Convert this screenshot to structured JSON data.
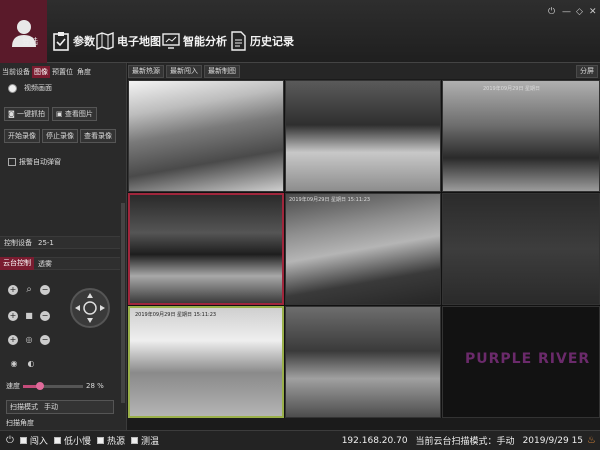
{
  "header": {
    "login_label": "登陆",
    "nav": [
      {
        "label": "参数",
        "icon": "clipboard-check-icon"
      },
      {
        "label": "电子地图",
        "icon": "map-icon"
      },
      {
        "label": "智能分析",
        "icon": "monitor-analysis-icon"
      },
      {
        "label": "历史记录",
        "icon": "history-document-icon"
      }
    ],
    "window_controls": [
      "power-icon",
      "minimize-icon",
      "restore-icon",
      "close-icon"
    ]
  },
  "left_panel": {
    "tabs": [
      "当前设备",
      "图像",
      "预置位",
      "角度"
    ],
    "active_tab": 1,
    "view_label": "视频画面",
    "buttons_row1": [
      "一键抓拍",
      "查看图片"
    ],
    "buttons_row2": [
      "开始录像",
      "停止录像",
      "查看录像"
    ],
    "alarm_label": "报警自动弹窗",
    "control_device_label": "控制设备",
    "control_device_value": "25-1",
    "ptz_tabs": [
      "云台控制",
      "透雾"
    ],
    "speed_label": "速度",
    "speed_value": "28 %",
    "speed_fraction": 0.28,
    "scan_mode_label": "扫描模式",
    "scan_mode_value": "手动",
    "scan_corner_label": "扫描角度"
  },
  "video_toolbar": {
    "buttons": [
      "最新热源",
      "最新闯入",
      "最新制图"
    ],
    "split_label": "分屏"
  },
  "cells": [
    {
      "id": 1,
      "timestamp": ""
    },
    {
      "id": 2,
      "timestamp": ""
    },
    {
      "id": 3,
      "timestamp": "2019年09月29日 星期日"
    },
    {
      "id": 4,
      "timestamp": ""
    },
    {
      "id": 5,
      "timestamp": "2019年09月29日 星期日 15:11:23"
    },
    {
      "id": 6,
      "timestamp": ""
    },
    {
      "id": 7,
      "timestamp": "2019年09月29日 星期日 15:11:23"
    },
    {
      "id": 8,
      "timestamp": ""
    },
    {
      "id": 9,
      "timestamp": ""
    }
  ],
  "brand_watermark": "PURPLE RIVER",
  "status_bar": {
    "items": [
      "闯入",
      "低小慢",
      "热源",
      "测温"
    ],
    "ip": "192.168.20.70",
    "scan_mode_text": "当前云台扫描模式：手动",
    "date": "2019/9/29 15"
  },
  "colors": {
    "accent": "#7a1c30",
    "background": "#1b1b1b"
  }
}
